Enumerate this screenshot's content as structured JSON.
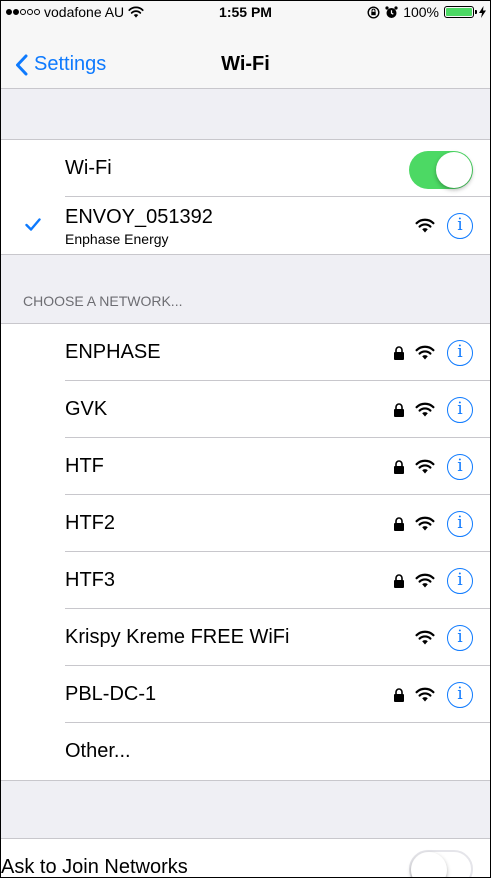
{
  "status_bar": {
    "carrier": "vodafone AU",
    "time": "1:55 PM",
    "battery": "100%",
    "signal_filled": 2,
    "signal_total": 5
  },
  "nav": {
    "back_label": "Settings",
    "title": "Wi-Fi"
  },
  "wifi_toggle": {
    "label": "Wi-Fi",
    "on": true
  },
  "connected": {
    "name": "ENVOY_051392",
    "subtitle": "Enphase Energy"
  },
  "choose_header": "CHOOSE A NETWORK...",
  "networks": [
    {
      "name": "ENPHASE",
      "locked": true
    },
    {
      "name": "GVK",
      "locked": true
    },
    {
      "name": "HTF",
      "locked": true
    },
    {
      "name": "HTF2",
      "locked": true
    },
    {
      "name": "HTF3",
      "locked": true
    },
    {
      "name": "Krispy Kreme FREE WiFi",
      "locked": false
    },
    {
      "name": "PBL-DC-1",
      "locked": true
    }
  ],
  "other_label": "Other...",
  "ask_to_join": {
    "label": "Ask to Join Networks",
    "on": false
  },
  "colors": {
    "accent": "#0e7afe",
    "toggle_on": "#4cd964",
    "background": "#efeff4",
    "separator": "#c8c7cc"
  }
}
